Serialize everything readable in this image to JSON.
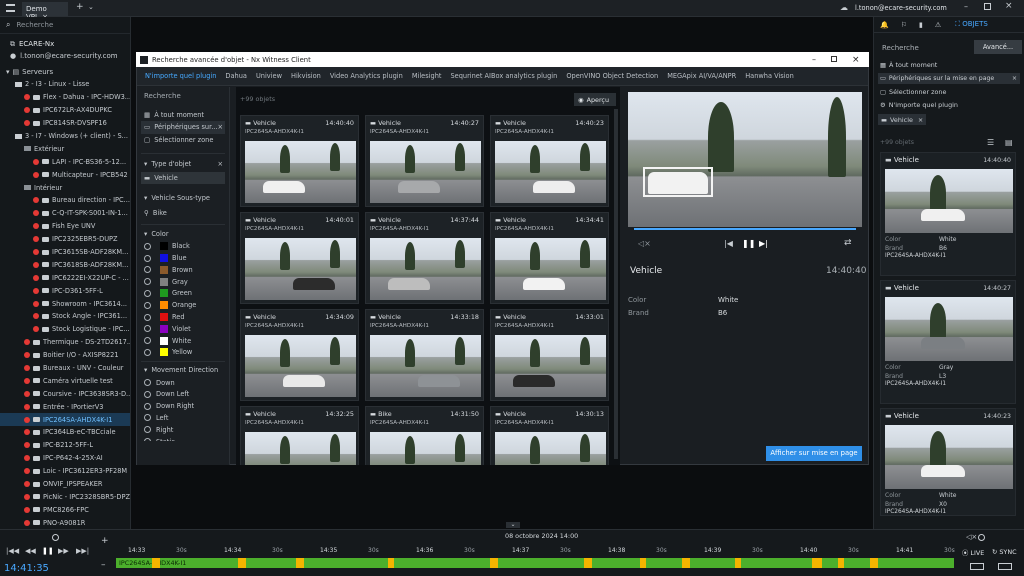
{
  "topbar": {
    "tab": "Demo VPI",
    "user": "l.tonon@ecare-security.com"
  },
  "left": {
    "search_placeholder": "Recherche",
    "system": "ECARE-Nx",
    "user": "l.tonon@ecare-security.com",
    "servers": "Serveurs",
    "items": [
      {
        "t": "2 - I3 - Linux - Lisse",
        "k": "server",
        "lvl": 1
      },
      {
        "t": "Flex - Dahua - IPC-HDW3...",
        "k": "cam",
        "lvl": 2
      },
      {
        "t": "IPC672LR-AX4DUPKC",
        "k": "cam",
        "lvl": 2
      },
      {
        "t": "IPC814SR-DVSPF16",
        "k": "cam",
        "lvl": 2
      },
      {
        "t": "3 - I7 - Windows (+ client) - S...",
        "k": "server",
        "lvl": 1
      },
      {
        "t": "Extérieur",
        "k": "folder",
        "lvl": 2
      },
      {
        "t": "LAPI - IPC-BS36-5-12...",
        "k": "cam",
        "lvl": 3
      },
      {
        "t": "Multicapteur - IPCB542",
        "k": "cam",
        "lvl": 3
      },
      {
        "t": "Intérieur",
        "k": "folder",
        "lvl": 2
      },
      {
        "t": "Bureau direction - IPC...",
        "k": "cam",
        "lvl": 3
      },
      {
        "t": "C-Q-IT-SPK-S001-IN-1...",
        "k": "cam",
        "lvl": 3
      },
      {
        "t": "Fish Eye UNV",
        "k": "cam",
        "lvl": 3
      },
      {
        "t": "IPC2325EBR5-DUPZ",
        "k": "cam",
        "lvl": 3
      },
      {
        "t": "IPC3615SB-ADF28KM...",
        "k": "cam",
        "lvl": 3
      },
      {
        "t": "IPC3618SB-ADF28KM...",
        "k": "cam",
        "lvl": 3
      },
      {
        "t": "IPC6222EI-X22UP-C - ...",
        "k": "cam",
        "lvl": 3
      },
      {
        "t": "IPC-D361-5FF-L",
        "k": "cam",
        "lvl": 3
      },
      {
        "t": "Showroom - IPC3614...",
        "k": "cam",
        "lvl": 3
      },
      {
        "t": "Stock Angle - IPC361...",
        "k": "cam",
        "lvl": 3
      },
      {
        "t": "Stock Logistique - IPC...",
        "k": "cam",
        "lvl": 3
      },
      {
        "t": "Thermique - DS-2TD2617...",
        "k": "cam",
        "lvl": 2
      },
      {
        "t": "Boitier I/O - AXISP8221",
        "k": "cam",
        "lvl": 2
      },
      {
        "t": "Bureaux - UNV - Couleur",
        "k": "cam",
        "lvl": 2
      },
      {
        "t": "Caméra virtuelle test",
        "k": "cam",
        "lvl": 2
      },
      {
        "t": "Coursive - IPC3638SR3-D...",
        "k": "cam",
        "lvl": 2
      },
      {
        "t": "Entrée - IPortierV3",
        "k": "cam",
        "lvl": 2
      },
      {
        "t": "IPC264SA-AHDX4K-I1",
        "k": "cam",
        "lvl": 2,
        "sel": true
      },
      {
        "t": "IPC364LB-eC-TBCciale",
        "k": "cam",
        "lvl": 2
      },
      {
        "t": "IPC-B212-5FF-L",
        "k": "cam",
        "lvl": 2
      },
      {
        "t": "IPC-P642-4-25X-AI",
        "k": "cam",
        "lvl": 2
      },
      {
        "t": "Loic - IPC3612ER3-PF28M",
        "k": "cam",
        "lvl": 2
      },
      {
        "t": "ONVIF_IPSPEAKER",
        "k": "cam",
        "lvl": 2
      },
      {
        "t": "PicNic - IPC2328SBR5-DPZ",
        "k": "cam",
        "lvl": 2
      },
      {
        "t": "PMC8266-FPC",
        "k": "cam",
        "lvl": 2
      },
      {
        "t": "PNO-A9081R",
        "k": "cam",
        "lvl": 2
      }
    ]
  },
  "dialog": {
    "title": "Recherche avancée d'objet - Nx Witness Client",
    "tabs": [
      "N'importe quel plugin",
      "Dahua",
      "Uniview",
      "Hikvision",
      "Video Analytics plugin",
      "Milesight",
      "Sequrinet AIBox analytics plugin",
      "OpenVINO Object Detection",
      "MEGApix AI/VA/ANPR",
      "Hanwha Vision"
    ],
    "search_placeholder": "Recherche",
    "time_filter": "À tout moment",
    "device_filter": "Périphériques sur...",
    "zone_filter": "Sélectionner zone",
    "object_type_label": "Type d'objet",
    "object_type_value": "Vehicle",
    "subtype_label": "Vehicle Sous-type",
    "subtype_value": "Bike",
    "color_label": "Color",
    "colors": [
      {
        "name": "Black",
        "hex": "#000000"
      },
      {
        "name": "Blue",
        "hex": "#1010e0"
      },
      {
        "name": "Brown",
        "hex": "#8b5a2b"
      },
      {
        "name": "Gray",
        "hex": "#808080"
      },
      {
        "name": "Green",
        "hex": "#1f9a1f"
      },
      {
        "name": "Orange",
        "hex": "#ff8c00"
      },
      {
        "name": "Red",
        "hex": "#e01010"
      },
      {
        "name": "Violet",
        "hex": "#8b00c0"
      },
      {
        "name": "White",
        "hex": "#ffffff"
      },
      {
        "name": "Yellow",
        "hex": "#ffff00"
      }
    ],
    "direction_label": "Movement Direction",
    "directions": [
      "Down",
      "Down Left",
      "Down Right",
      "Left",
      "Right",
      "Static",
      "Up"
    ],
    "results_count": "+99 objets",
    "preview_button": "Aperçu",
    "results": [
      {
        "type": "Vehicle",
        "time": "14:40:40",
        "cam": "IPC264SA-AHDX4K-I1"
      },
      {
        "type": "Vehicle",
        "time": "14:40:27",
        "cam": "IPC264SA-AHDX4K-I1"
      },
      {
        "type": "Vehicle",
        "time": "14:40:23",
        "cam": "IPC264SA-AHDX4K-I1"
      },
      {
        "type": "Vehicle",
        "time": "14:40:01",
        "cam": "IPC264SA-AHDX4K-I1"
      },
      {
        "type": "Vehicle",
        "time": "14:37:44",
        "cam": "IPC264SA-AHDX4K-I1"
      },
      {
        "type": "Vehicle",
        "time": "14:34:41",
        "cam": "IPC264SA-AHDX4K-I1"
      },
      {
        "type": "Vehicle",
        "time": "14:34:09",
        "cam": "IPC264SA-AHDX4K-I1"
      },
      {
        "type": "Vehicle",
        "time": "14:33:18",
        "cam": "IPC264SA-AHDX4K-I1"
      },
      {
        "type": "Vehicle",
        "time": "14:33:01",
        "cam": "IPC264SA-AHDX4K-I1"
      },
      {
        "type": "Vehicle",
        "time": "14:32:25",
        "cam": "IPC264SA-AHDX4K-I1"
      },
      {
        "type": "Bike",
        "time": "14:31:50",
        "cam": "IPC264SA-AHDX4K-I1"
      },
      {
        "type": "Vehicle",
        "time": "14:30:13",
        "cam": "IPC264SA-AHDX4K-I1"
      }
    ],
    "detail": {
      "type": "Vehicle",
      "time": "14:40:40",
      "color_label": "Color",
      "color_value": "White",
      "brand_label": "Brand",
      "brand_value": "B6"
    },
    "show_button": "Afficher sur mise en page"
  },
  "right": {
    "tab_label": "OBJETS",
    "search_placeholder": "Recherche",
    "advanced_button": "Avancé...",
    "time_filter": "À tout moment",
    "device_filter": "Périphériques sur la mise en page",
    "zone_filter": "Sélectionner zone",
    "plugin_filter": "N'importe quel plugin",
    "type_chip": "Vehicle",
    "count": "+99 objets",
    "cards": [
      {
        "type": "Vehicle",
        "time": "14:40:40",
        "color": "White",
        "brand": "B6",
        "cam": "IPC264SA-AHDX4K-I1"
      },
      {
        "type": "Vehicle",
        "time": "14:40:27",
        "color": "Gray",
        "brand": "L3",
        "cam": "IPC264SA-AHDX4K-I1"
      },
      {
        "type": "Vehicle",
        "time": "14:40:23",
        "color": "White",
        "brand": "X0",
        "cam": "IPC264SA-AHDX4K-I1"
      }
    ],
    "color_label": "Color",
    "brand_label": "Brand"
  },
  "timeline": {
    "time": "14:41:35",
    "date": "08 octobre 2024 14:00",
    "camera": "IPC264SA-AHDX4K-I1",
    "ticks": [
      "14:33",
      "30s",
      "14:34",
      "30s",
      "14:35",
      "30s",
      "14:36",
      "30s",
      "14:37",
      "30s",
      "14:38",
      "30s",
      "14:39",
      "30s",
      "14:40",
      "30s",
      "14:41",
      "30s"
    ],
    "live": "LIVE",
    "sync": "SYNC"
  }
}
